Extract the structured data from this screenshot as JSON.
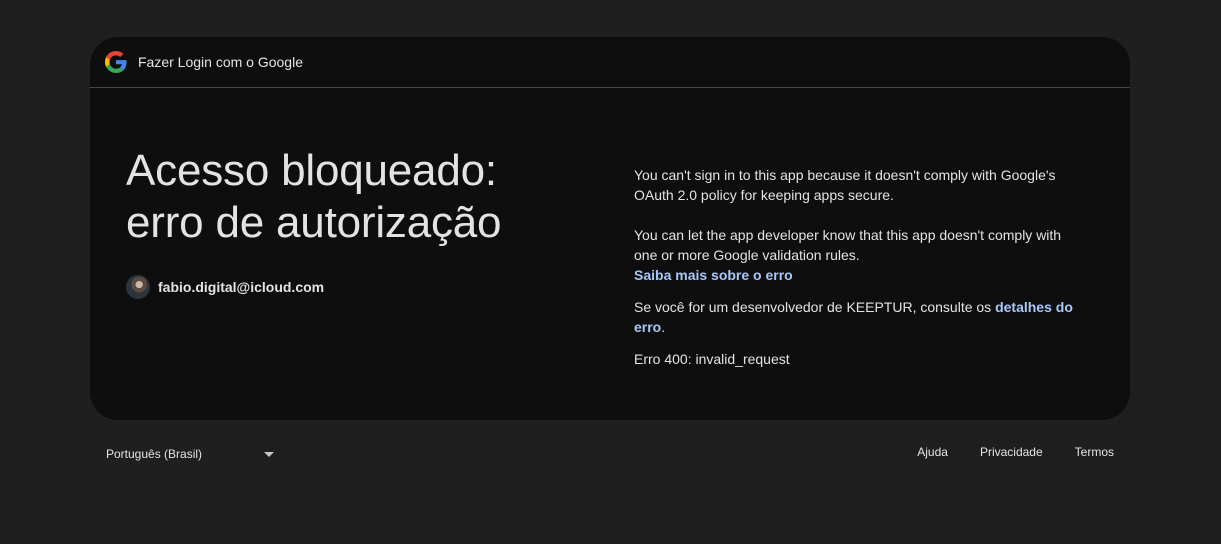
{
  "header": {
    "title": "Fazer Login com o Google",
    "logo_icon": "google-g-logo"
  },
  "main": {
    "headline_line1": "Acesso bloqueado:",
    "headline_line2": "erro de autorização",
    "account": {
      "email": "fabio.digital@icloud.com"
    },
    "messages": {
      "paragraph1": "You can't sign in to this app because it doesn't comply with Google's OAuth 2.0 policy for keeping apps secure.",
      "paragraph2": "You can let the app developer know that this app doesn't comply with one or more Google validation rules.",
      "learn_more_link": "Saiba mais sobre o erro",
      "developer_prefix": "Se você for um desenvolvedor de KEEPTUR, consulte os ",
      "developer_link": "detalhes do erro",
      "developer_suffix": ".",
      "error_code": "Erro 400: invalid_request"
    }
  },
  "footer": {
    "language": "Português (Brasil)",
    "links": {
      "help": "Ajuda",
      "privacy": "Privacidade",
      "terms": "Termos"
    }
  },
  "colors": {
    "page_bg": "#1f1f20",
    "card_bg": "#0e0e0e",
    "text": "#e3e3e3",
    "link": "#a8c7fa"
  }
}
